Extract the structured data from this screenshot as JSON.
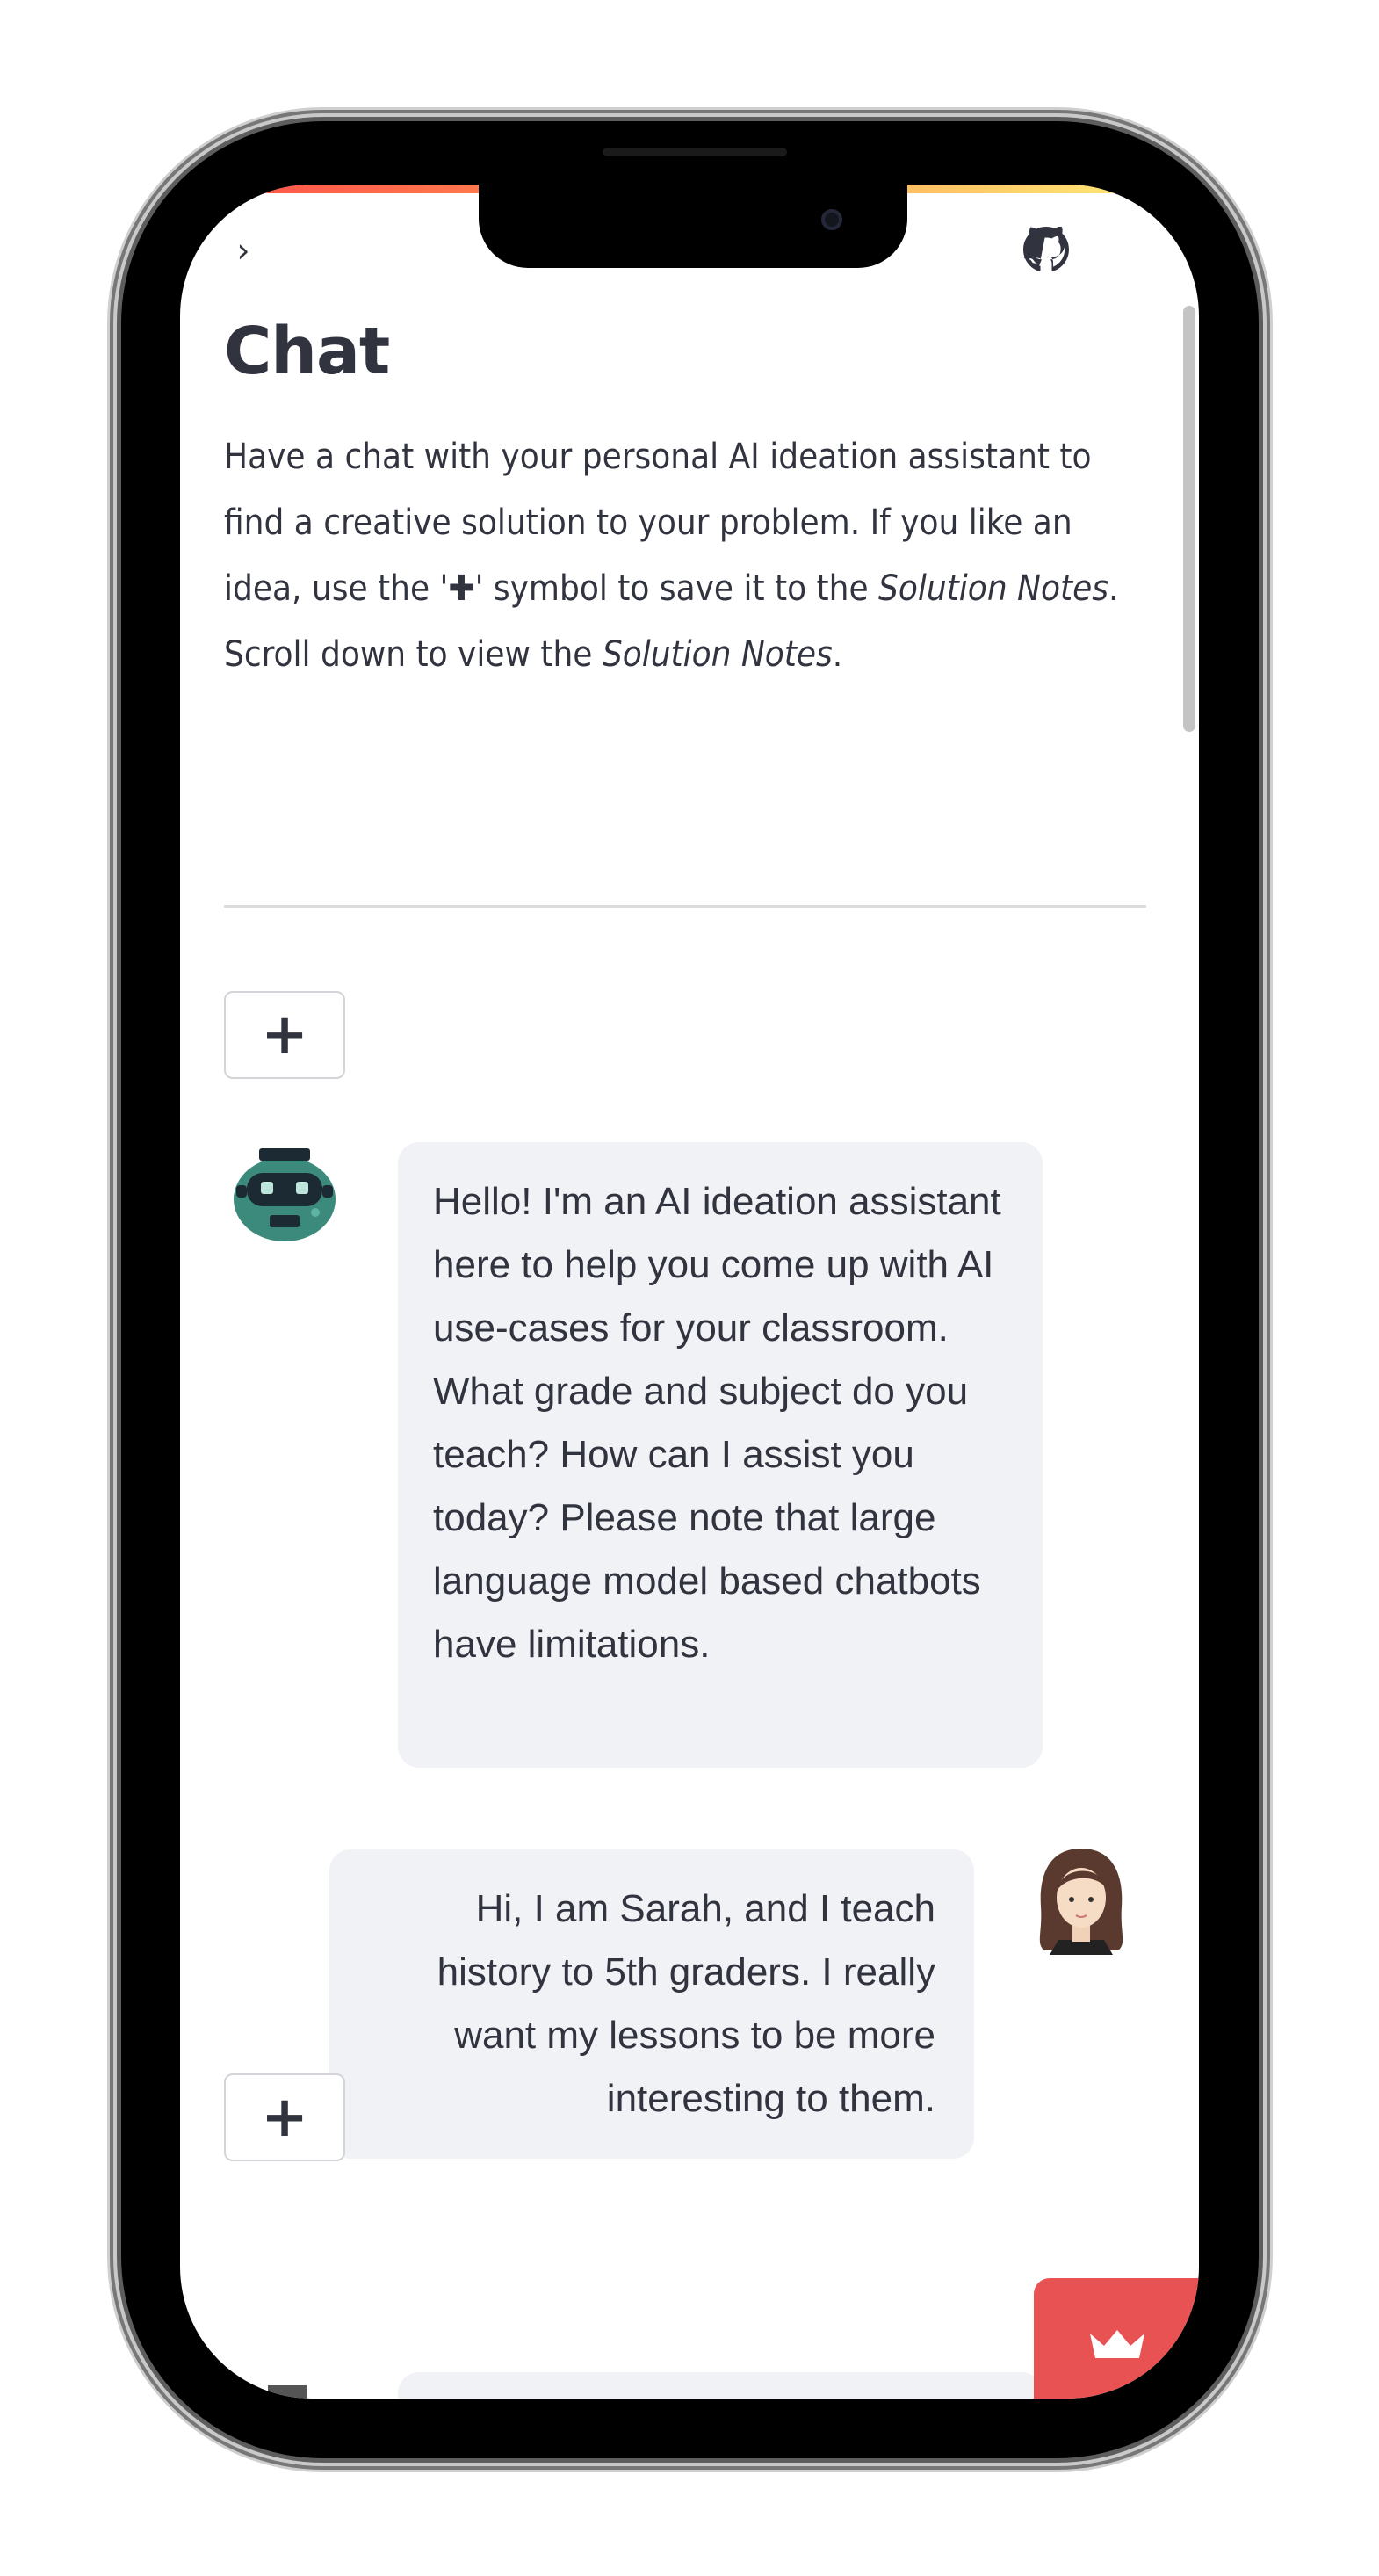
{
  "header": {
    "sidebar_toggle_glyph": "›",
    "github_icon": "github-icon"
  },
  "page": {
    "title": "Chat",
    "intro": {
      "part1": "Have a chat with your personal AI ideation assistant to find a creative solution to your problem. If you like an idea, use the '",
      "plus_symbol": "✚",
      "part2": "' symbol to save it to the ",
      "notes_label_1": "Solution Notes",
      "part3": ". Scroll down to view the ",
      "notes_label_2": "Solution Notes",
      "part4": "."
    }
  },
  "chat": {
    "add_button_label": "+",
    "messages": [
      {
        "role": "assistant",
        "text": "Hello! I'm an AI ideation assistant here to help you come up with AI use-cases for your classroom. What grade and subject do you teach? How can I assist you today? Please note that large language model based chatbots have limitations."
      },
      {
        "role": "user",
        "text": "Hi, I am Sarah, and I teach history to 5th graders. I really want my lessons to be more interesting to them."
      }
    ]
  },
  "colors": {
    "accent": "#ff4b4b",
    "bubble": "#f0f2f6",
    "text": "#31333f",
    "streamlit_badge": "#e95252"
  }
}
